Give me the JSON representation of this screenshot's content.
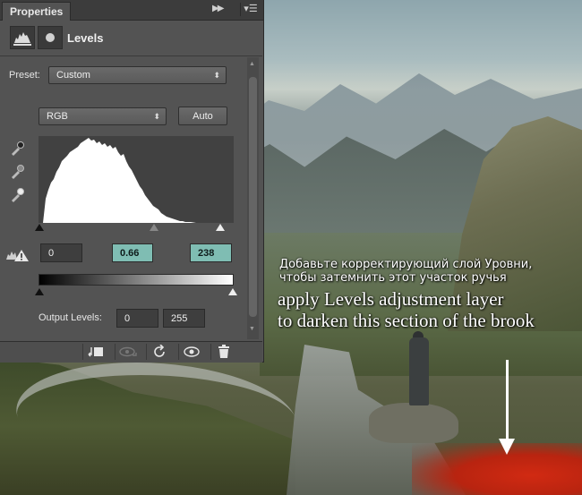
{
  "panel": {
    "tab_label": "Properties",
    "title": "Levels",
    "preset_label": "Preset:",
    "preset_value": "Custom",
    "channel_value": "RGB",
    "auto_label": "Auto",
    "input_black": "0",
    "input_midtone": "0.66",
    "input_white": "238",
    "output_label": "Output Levels:",
    "output_black": "0",
    "output_white": "255",
    "icons": [
      "adjustment-levels-icon",
      "mask-icon",
      "black-point-eyedropper-icon",
      "gray-point-eyedropper-icon",
      "white-point-eyedropper-icon",
      "levels-warning-icon",
      "clip-to-layer-icon",
      "view-previous-state-icon",
      "reset-icon",
      "visibility-eye-icon",
      "trash-icon"
    ],
    "accent_color": "#7fbdb3"
  },
  "captions": {
    "ru_line1": "Добавьте корректирующий слой Уровни,",
    "ru_line2": "чтобы затемнить этот участок ручья",
    "en_line1": "apply Levels adjustment layer",
    "en_line2": "to darken this section of the brook"
  }
}
